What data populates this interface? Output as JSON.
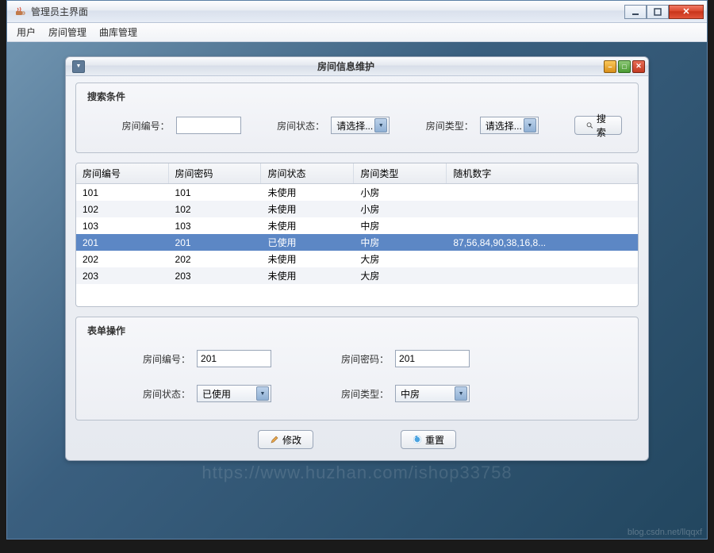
{
  "window": {
    "title": "管理员主界面"
  },
  "menu": {
    "items": [
      "用户",
      "房间管理",
      "曲库管理"
    ]
  },
  "dialog": {
    "title": "房间信息维护"
  },
  "search_panel": {
    "title": "搜索条件",
    "room_number_label": "房间编号：",
    "room_number_value": "",
    "room_status_label": "房间状态：",
    "room_status_value": "请选择...",
    "room_type_label": "房间类型：",
    "room_type_value": "请选择...",
    "search_button": "搜索"
  },
  "table": {
    "columns": [
      "房间编号",
      "房间密码",
      "房间状态",
      "房间类型",
      "随机数字"
    ],
    "rows": [
      {
        "c0": "101",
        "c1": "101",
        "c2": "未使用",
        "c3": "小房",
        "c4": ""
      },
      {
        "c0": "102",
        "c1": "102",
        "c2": "未使用",
        "c3": "小房",
        "c4": ""
      },
      {
        "c0": "103",
        "c1": "103",
        "c2": "未使用",
        "c3": "中房",
        "c4": ""
      },
      {
        "c0": "201",
        "c1": "201",
        "c2": "已使用",
        "c3": "中房",
        "c4": "87,56,84,90,38,16,8..."
      },
      {
        "c0": "202",
        "c1": "202",
        "c2": "未使用",
        "c3": "大房",
        "c4": ""
      },
      {
        "c0": "203",
        "c1": "203",
        "c2": "未使用",
        "c3": "大房",
        "c4": ""
      }
    ],
    "selected_index": 3
  },
  "form_panel": {
    "title": "表单操作",
    "room_number_label": "房间编号：",
    "room_number_value": "201",
    "room_password_label": "房间密码：",
    "room_password_value": "201",
    "room_status_label": "房间状态：",
    "room_status_value": "已使用",
    "room_type_label": "房间类型：",
    "room_type_value": "中房"
  },
  "buttons": {
    "modify": "修改",
    "reset": "重置"
  },
  "watermark": "https://www.huzhan.com/ishop33758",
  "watermark2": "blog.csdn.net/llqqxf"
}
